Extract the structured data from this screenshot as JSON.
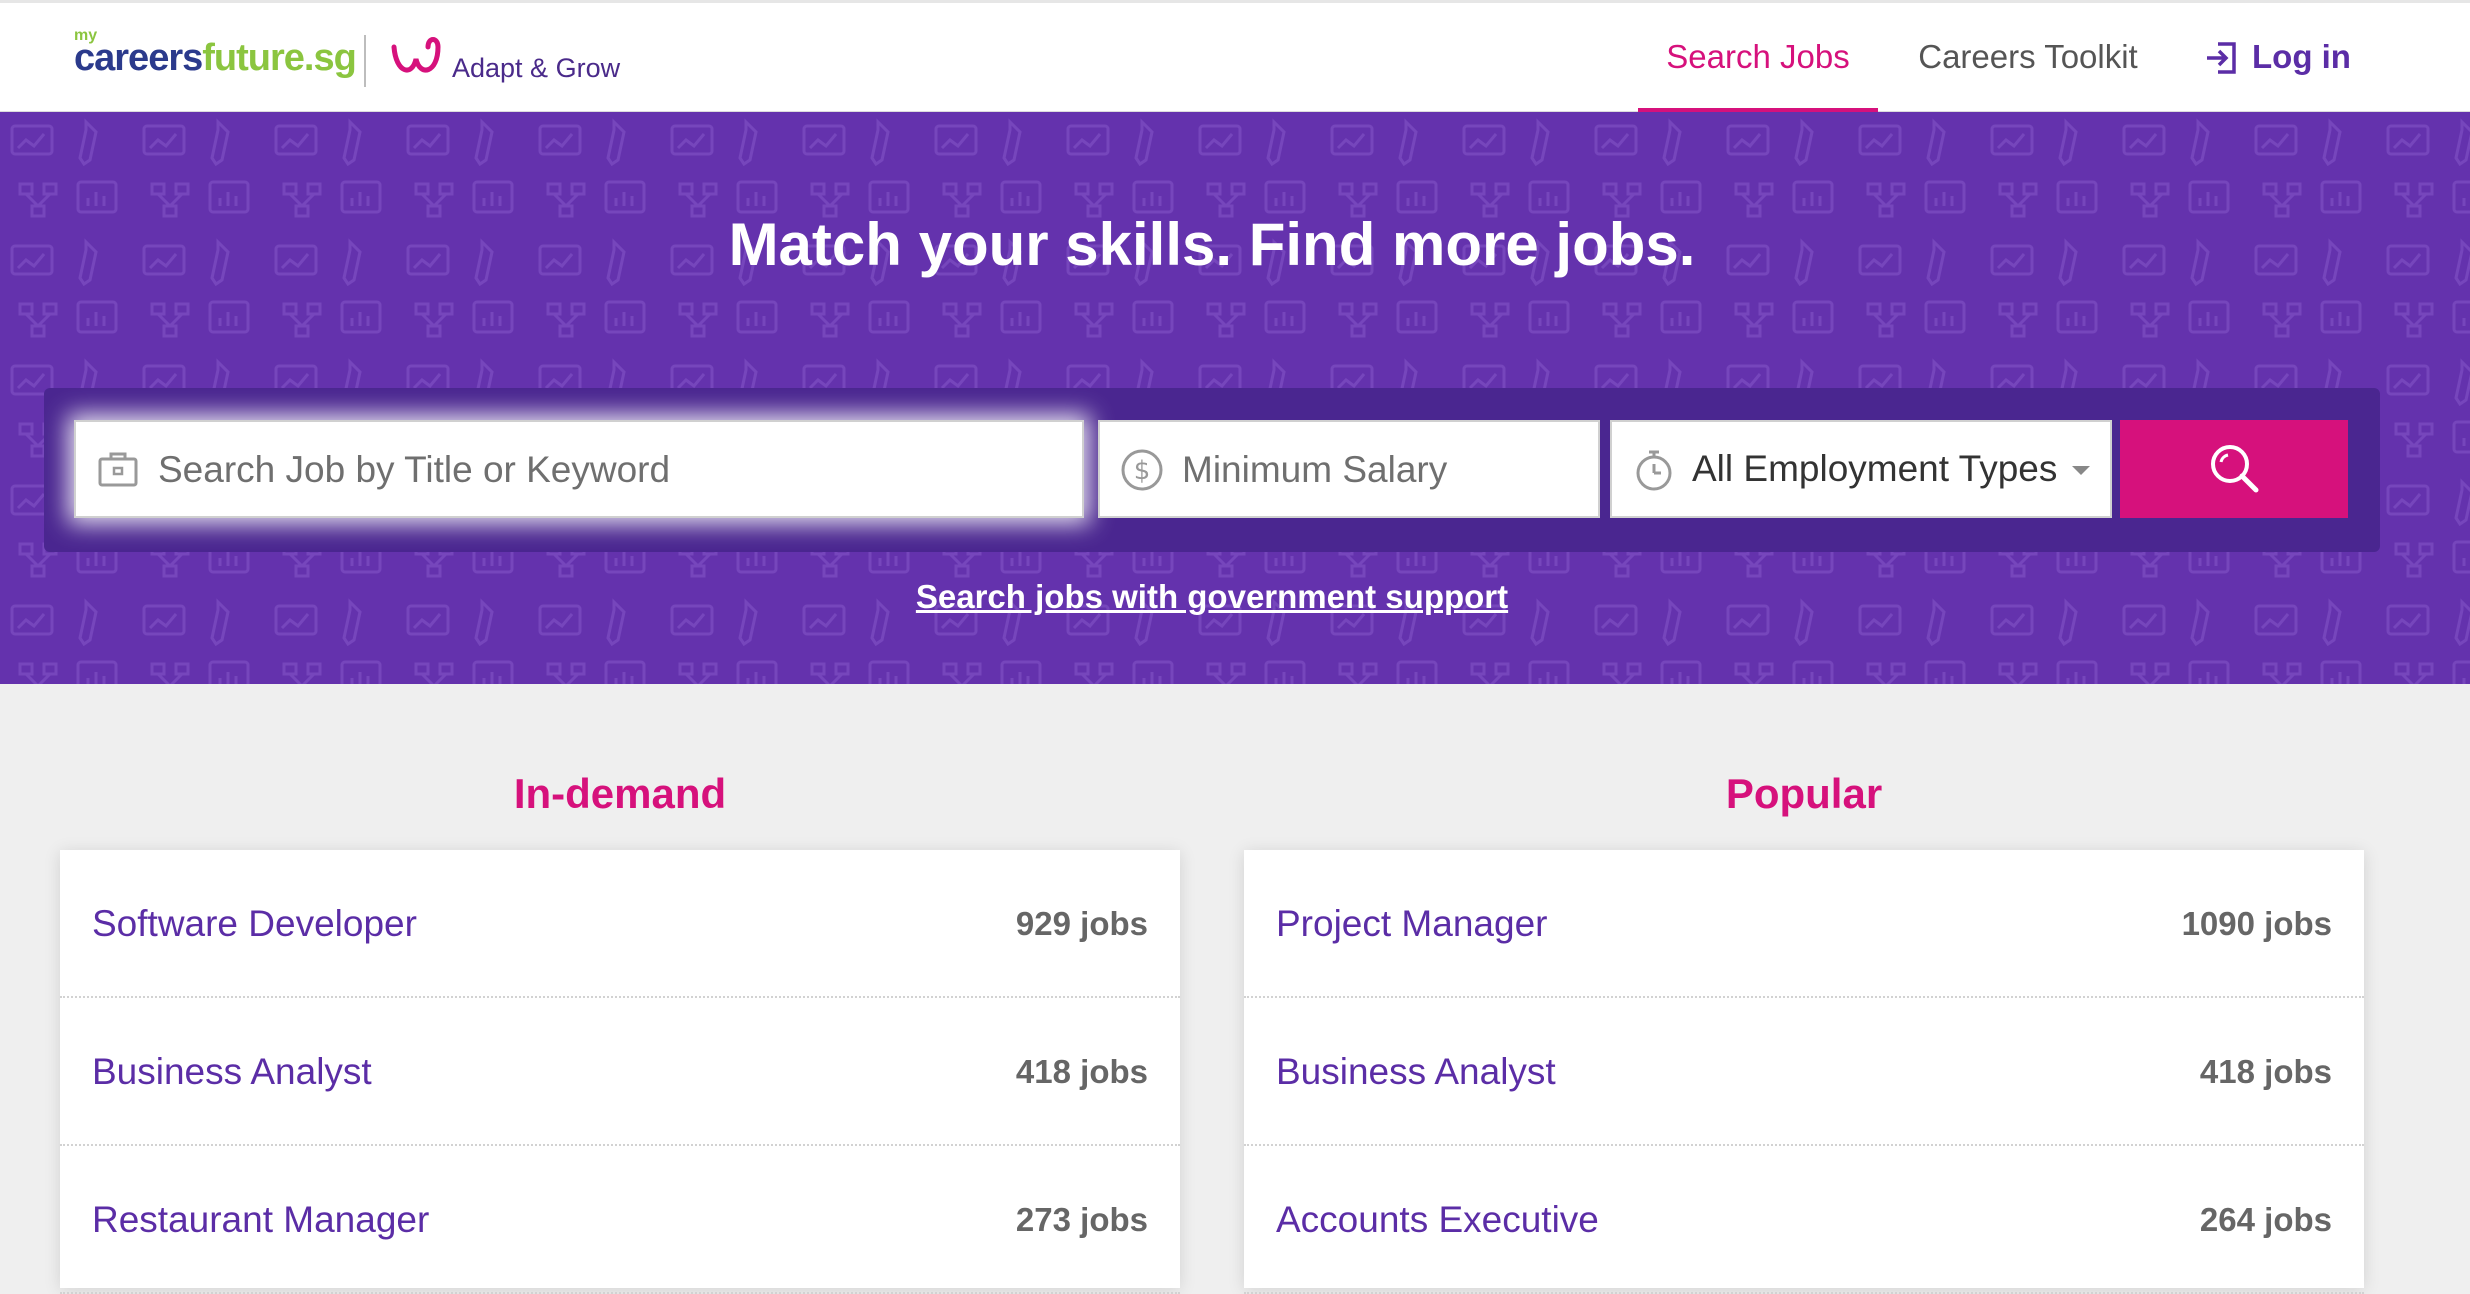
{
  "header": {
    "logo": {
      "my": "my",
      "part1": "careers",
      "part2": "future.sg"
    },
    "partner_logo": "Adapt & Grow",
    "nav": [
      {
        "label": "Search Jobs",
        "active": true
      },
      {
        "label": "Careers Toolkit",
        "active": false
      },
      {
        "label": "Log in",
        "icon": "login-icon"
      }
    ]
  },
  "hero": {
    "title": "Match your skills. Find more jobs.",
    "search": {
      "keyword_placeholder": "Search Job by Title or Keyword",
      "keyword_icon": "briefcase-icon",
      "salary_placeholder": "Minimum Salary",
      "salary_icon": "dollar-icon",
      "employment_type": "All Employment Types",
      "employment_icon": "stopwatch-icon",
      "button_icon": "search-icon"
    },
    "gov_link": "Search jobs with government support"
  },
  "in_demand": {
    "title": "In-demand",
    "items": [
      {
        "role": "Software Developer",
        "count": "929 jobs"
      },
      {
        "role": "Business Analyst",
        "count": "418 jobs"
      },
      {
        "role": "Restaurant Manager",
        "count": "273 jobs"
      }
    ]
  },
  "popular": {
    "title": "Popular",
    "items": [
      {
        "role": "Project Manager",
        "count": "1090 jobs"
      },
      {
        "role": "Business Analyst",
        "count": "418 jobs"
      },
      {
        "role": "Accounts Executive",
        "count": "264 jobs"
      }
    ]
  },
  "colors": {
    "primary_purple": "#6432ad",
    "accent_pink": "#d6117c",
    "link_purple": "#5b2da6",
    "brand_green": "#8bc53f",
    "brand_navy": "#2b3a8c"
  }
}
